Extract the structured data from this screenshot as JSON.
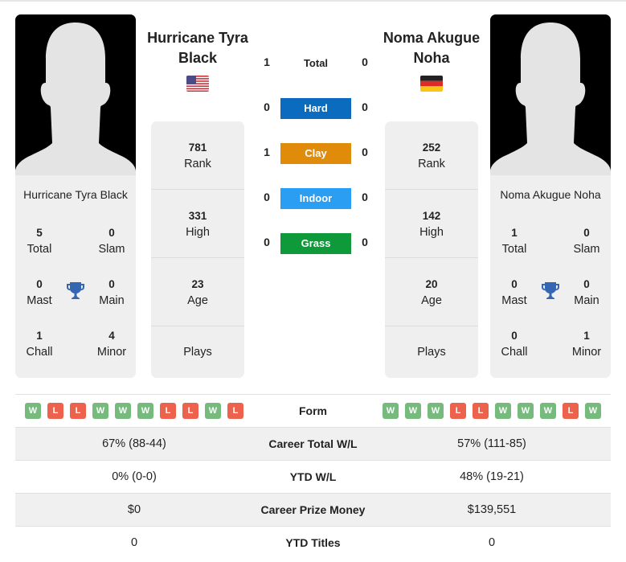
{
  "colors": {
    "hard": "#0b6bbf",
    "clay": "#e08c0a",
    "indoor": "#2a9ef2",
    "grass": "#0e9a3a",
    "win": "#76bb7d",
    "loss": "#ec624c",
    "trophy": "#3566b1"
  },
  "players": {
    "left": {
      "name": "Hurricane Tyra Black",
      "flag": "usa-flag",
      "card_name": "Hurricane Tyra Black",
      "titles": {
        "total": {
          "value": "5",
          "label": "Total"
        },
        "slam": {
          "value": "0",
          "label": "Slam"
        },
        "mast": {
          "value": "0",
          "label": "Mast"
        },
        "main": {
          "value": "0",
          "label": "Main"
        },
        "chall": {
          "value": "1",
          "label": "Chall"
        },
        "minor": {
          "value": "4",
          "label": "Minor"
        }
      },
      "info": {
        "rank": {
          "value": "781",
          "label": "Rank"
        },
        "high": {
          "value": "331",
          "label": "High"
        },
        "age": {
          "value": "23",
          "label": "Age"
        },
        "plays": {
          "value": "",
          "label": "Plays"
        }
      },
      "form": [
        "W",
        "L",
        "L",
        "W",
        "W",
        "W",
        "L",
        "L",
        "W",
        "L"
      ],
      "career_wl": "67% (88-44)",
      "ytd_wl": "0% (0-0)",
      "prize_money": "$0",
      "ytd_titles": "0"
    },
    "right": {
      "name": "Noma Akugue Noha",
      "flag": "germany-flag",
      "card_name": "Noma Akugue Noha",
      "titles": {
        "total": {
          "value": "1",
          "label": "Total"
        },
        "slam": {
          "value": "0",
          "label": "Slam"
        },
        "mast": {
          "value": "0",
          "label": "Mast"
        },
        "main": {
          "value": "0",
          "label": "Main"
        },
        "chall": {
          "value": "0",
          "label": "Chall"
        },
        "minor": {
          "value": "1",
          "label": "Minor"
        }
      },
      "info": {
        "rank": {
          "value": "252",
          "label": "Rank"
        },
        "high": {
          "value": "142",
          "label": "High"
        },
        "age": {
          "value": "20",
          "label": "Age"
        },
        "plays": {
          "value": "",
          "label": "Plays"
        }
      },
      "form": [
        "W",
        "W",
        "W",
        "L",
        "L",
        "W",
        "W",
        "W",
        "L",
        "W"
      ],
      "career_wl": "57% (111-85)",
      "ytd_wl": "48% (19-21)",
      "prize_money": "$139,551",
      "ytd_titles": "0"
    }
  },
  "h2h": [
    {
      "label": "Total",
      "left": "1",
      "right": "0",
      "surface": "total"
    },
    {
      "label": "Hard",
      "left": "0",
      "right": "0",
      "surface": "hard"
    },
    {
      "label": "Clay",
      "left": "1",
      "right": "0",
      "surface": "clay"
    },
    {
      "label": "Indoor",
      "left": "0",
      "right": "0",
      "surface": "indoor"
    },
    {
      "label": "Grass",
      "left": "0",
      "right": "0",
      "surface": "grass"
    }
  ],
  "table": {
    "form_label": "Form",
    "career_wl_label": "Career Total W/L",
    "ytd_wl_label": "YTD W/L",
    "prize_label": "Career Prize Money",
    "ytd_titles_label": "YTD Titles"
  }
}
